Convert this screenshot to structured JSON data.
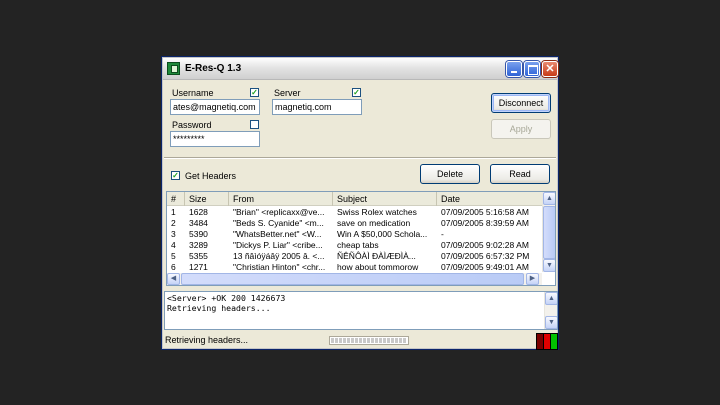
{
  "window": {
    "title": "E-Res-Q 1.3"
  },
  "form": {
    "username_label": "Username",
    "username_value": "ates@magnetiq.com",
    "username_checked": "✓",
    "server_label": "Server",
    "server_value": "magnetiq.com",
    "server_checked": "✓",
    "password_label": "Password",
    "password_value": "*********",
    "password_checked": ""
  },
  "buttons": {
    "disconnect": "Disconnect",
    "apply": "Apply",
    "delete": "Delete",
    "read": "Read"
  },
  "options": {
    "get_headers_label": "Get Headers",
    "get_headers_checked": "✓"
  },
  "messages": {
    "columns": [
      "#",
      "Size",
      "From",
      "Subject",
      "Date"
    ],
    "rows": [
      [
        "1",
        "1628",
        "\"Brian\" <replicaxx@ve...",
        "Swiss Rolex watches",
        "07/09/2005 5:16:58 AM"
      ],
      [
        "2",
        "3484",
        "\"Beds S. Cyanide\" <m...",
        "save on medication",
        "07/09/2005 8:39:59 AM"
      ],
      [
        "3",
        "5390",
        "\"WhatsBetter.net\" <W...",
        "Win A $50,000 Schola...",
        "-"
      ],
      [
        "4",
        "3289",
        "\"Dickys P. Liar\" <cribe...",
        "cheap tabs",
        "07/09/2005 9:02:28 AM"
      ],
      [
        "5",
        "5355",
        "13 ñâìóÿáâÿ 2005 â. <...",
        "ÑÊÑÔÀÌ ÐÀÌÆÐÌÀ...",
        "07/09/2005 6:57:32 PM"
      ],
      [
        "6",
        "1271",
        "\"Christian Hinton\" <chr...",
        "how about tommorow",
        "07/09/2005 9:49:01 AM"
      ]
    ]
  },
  "log": {
    "lines": [
      "<Server> +OK 200 1426673",
      "Retrieving headers..."
    ]
  },
  "status": {
    "text": "Retrieving headers..."
  },
  "colors": {
    "led_dark": "#7a0000",
    "led_red": "#e00000",
    "led_green": "#00c000"
  }
}
